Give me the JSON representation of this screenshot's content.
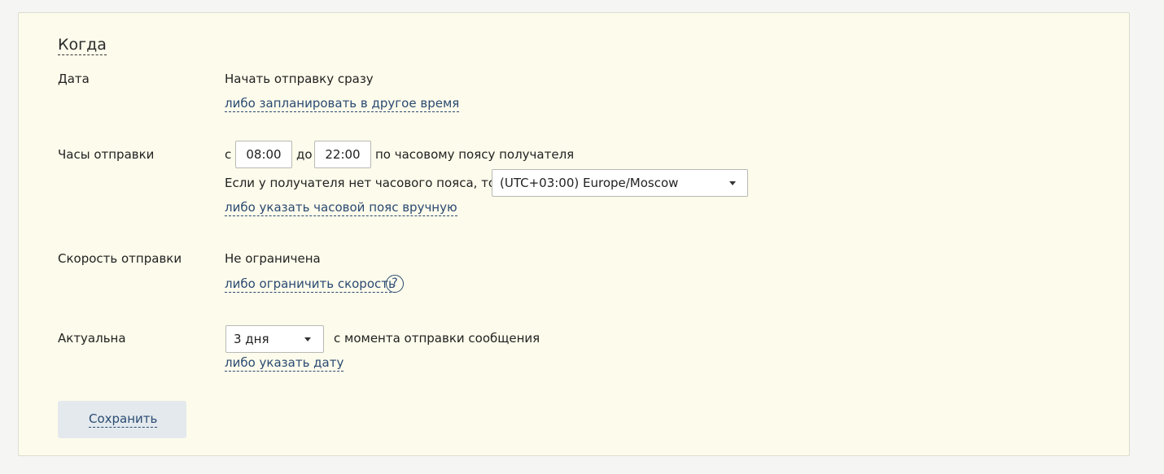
{
  "section": {
    "title": "Когда"
  },
  "date": {
    "label": "Дата",
    "value": "Начать отправку сразу",
    "link": "либо запланировать в другое время"
  },
  "hours": {
    "label": "Часы отправки",
    "from_prefix": "с",
    "from_value": "08:00",
    "to_prefix": "до",
    "to_value": "22:00",
    "suffix": "по часовому поясу получателя",
    "fallback_text": "Если у получателя нет часового пояса, то по",
    "timezone": "(UTC+03:00) Europe/Moscow",
    "link": "либо указать часовой пояс вручную"
  },
  "speed": {
    "label": "Скорость отправки",
    "value": "Не ограничена",
    "link": "либо ограничить скорость",
    "help_icon": "question-circle-icon",
    "help_symbol": "?"
  },
  "relevance": {
    "label": "Актуальна",
    "selected": "3 дня",
    "suffix": "с момента отправки сообщения",
    "link": "либо указать дату"
  },
  "actions": {
    "save_label": "Сохранить"
  },
  "colors": {
    "panel_background": "#fdfbeb",
    "link": "#2a4a72",
    "save_button_background": "#e3e9ed"
  }
}
